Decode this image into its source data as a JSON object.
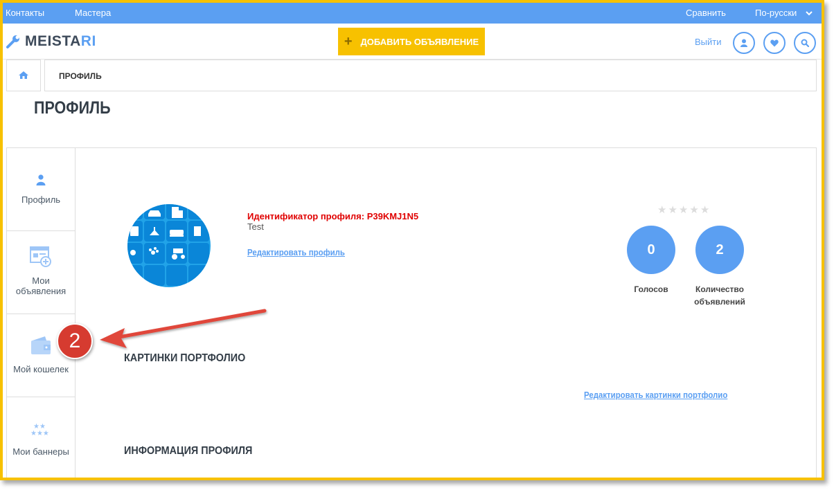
{
  "topbar": {
    "contacts": "Контакты",
    "masters": "Мастера",
    "compare": "Сравнить",
    "language": "По-русски"
  },
  "header": {
    "logo_main": "MEISTA",
    "logo_accent": "RI",
    "add_listing": "ДОБАВИТЬ ОБЪЯВЛЕНИЕ",
    "logout": "Выйти",
    "icons": [
      "user-icon",
      "heart-icon",
      "search-icon"
    ]
  },
  "breadcrumb": {
    "current": "ПРОФИЛЬ"
  },
  "page_title": "ПРОФИЛЬ",
  "sidebar": {
    "items": [
      {
        "label": "Профиль",
        "icon": "user-icon"
      },
      {
        "label": "Мои объявления",
        "icon": "listing-add-icon"
      },
      {
        "label": "Мой кошелек",
        "icon": "wallet-icon"
      },
      {
        "label": "Мои баннеры",
        "icon": "stars-icon"
      }
    ]
  },
  "profile": {
    "id_text": "Идентификатор профиля: P39KMJ1N5",
    "name": "Test",
    "edit_link": "Редактировать профиль",
    "rating_stars": 0,
    "votes_value": "0",
    "votes_label": "Голосов",
    "listings_value": "2",
    "listings_label": "Количество объявлений"
  },
  "portfolio": {
    "heading": "КАРТИНКИ ПОРТФОЛИО",
    "edit_link": "Редактировать картинки портфолио"
  },
  "info": {
    "heading": "ИНФОРМАЦИЯ ПРОФИЛЯ"
  },
  "annotation": {
    "step": "2"
  },
  "colors": {
    "frame": "#f7c100",
    "primary": "#5b9ff2",
    "accent_button": "#f7c100",
    "id_text": "#e00000",
    "badge": "#d63b30"
  }
}
